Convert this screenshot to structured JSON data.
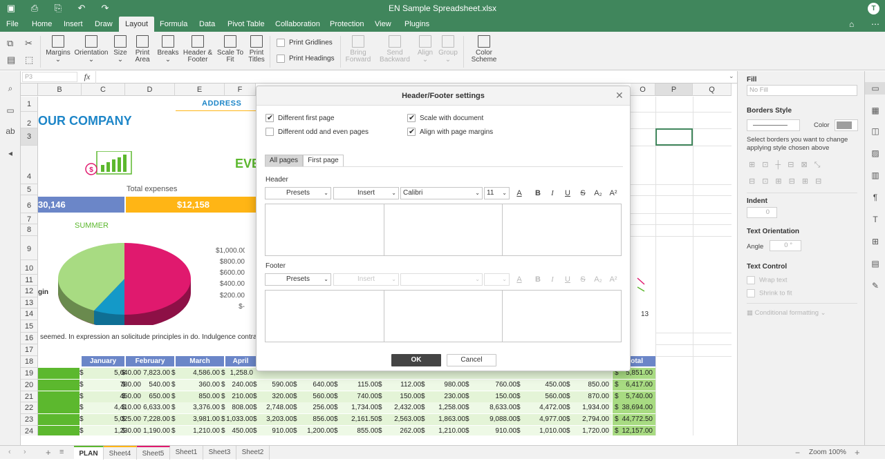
{
  "title_bar": {
    "doc_title": "EN Sample Spreadsheet.xlsx",
    "avatar_letter": "T"
  },
  "menu": {
    "tabs": [
      "File",
      "Home",
      "Insert",
      "Draw",
      "Layout",
      "Formula",
      "Data",
      "Pivot Table",
      "Collaboration",
      "Protection",
      "View",
      "Plugins"
    ]
  },
  "toolbar": {
    "margins": "Margins",
    "orientation": "Orientation",
    "size": "Size",
    "print_area_1": "Print",
    "print_area_2": "Area",
    "breaks": "Breaks",
    "header_footer_1": "Header &",
    "header_footer_2": "Footer",
    "scale_1": "Scale To",
    "scale_2": "Fit",
    "print_titles_1": "Print",
    "print_titles_2": "Titles",
    "print_gridlines": "Print Gridlines",
    "print_headings": "Print Headings",
    "bring_1": "Bring",
    "bring_2": "Forward",
    "send_1": "Send",
    "send_2": "Backward",
    "align": "Align",
    "group": "Group",
    "color_scheme_1": "Color",
    "color_scheme_2": "Scheme"
  },
  "formula_bar": {
    "name_box": "P3",
    "fx": "fx"
  },
  "columns": [
    "B",
    "C",
    "D",
    "E",
    "F",
    "O",
    "P",
    "Q"
  ],
  "rows": [
    "1",
    "2",
    "3",
    "4",
    "5",
    "6",
    "7",
    "8",
    "9",
    "10",
    "11",
    "12",
    "13",
    "14",
    "15",
    "16",
    "17",
    "18",
    "19",
    "20",
    "21",
    "22",
    "23",
    "24"
  ],
  "sheet": {
    "address": "ADDRESS",
    "company": "OUR COMPANY",
    "eve": "EVE",
    "total_expenses": "Total expenses",
    "value_left": "30,146",
    "value_center": "$12,158",
    "summer": "SUMMER",
    "margin": "gin",
    "y_ticks": [
      "$1,000.00",
      "$800.00",
      "$600.00",
      "$400.00",
      "$200.00",
      "$-"
    ],
    "text_row16": "seemed. In expression an solicitude principles in do. Indulgence contrasted suffi",
    "x_label_13": "13",
    "month_headers": [
      "January",
      "February",
      "March",
      "April"
    ],
    "total_header": "otal",
    "data_rows": [
      {
        "b": "5,640.00",
        "c": "7,823.00",
        "d": "4,586.00",
        "e": "1,258.0",
        "total": "5,851.00"
      },
      {
        "b": "780.00",
        "c": "540.00",
        "d": "360.00",
        "e": "240.00",
        "f": "590.00",
        "g": "640.00",
        "h": "115.00",
        "i": "112.00",
        "j": "980.00",
        "k": "760.00",
        "l": "450.00",
        "m": "850.00",
        "total": "6,417.00"
      },
      {
        "b": "450.00",
        "c": "650.00",
        "d": "850.00",
        "e": "210.00",
        "f": "320.00",
        "g": "560.00",
        "h": "740.00",
        "i": "150.00",
        "j": "230.00",
        "k": "150.00",
        "l": "560.00",
        "m": "870.00",
        "total": "5,740.00"
      },
      {
        "b": "4,410.00",
        "c": "6,633.00",
        "d": "3,376.00",
        "e": "808.00",
        "f": "2,748.00",
        "g": "256.00",
        "h": "1,734.00",
        "i": "2,432.00",
        "j": "1,258.00",
        "k": "8,633.00",
        "l": "4,472.00",
        "m": "1,934.00",
        "total": "38,694.00"
      },
      {
        "b": "5,025.00",
        "c": "7,228.00",
        "d": "3,981.00",
        "e": "1,033.00",
        "f": "3,203.00",
        "g": "856.00",
        "h": "2,161.50",
        "i": "2,563.00",
        "j": "1,863.00",
        "k": "9,088.00",
        "l": "4,977.00",
        "m": "2,794.00",
        "total": "44,772.50"
      },
      {
        "b": "1,230.00",
        "c": "1,190.00",
        "d": "1,210.00",
        "e": "450.00",
        "f": "910.00",
        "g": "1,200.00",
        "h": "855.00",
        "i": "262.00",
        "j": "1,210.00",
        "k": "910.00",
        "l": "1,010.00",
        "m": "1,720.00",
        "total": "12,157.00"
      }
    ]
  },
  "right_panel": {
    "fill": "Fill",
    "fill_value": "No Fill",
    "borders_style": "Borders Style",
    "color": "Color",
    "borders_hint": "Select borders you want to change applying style chosen above",
    "indent": "Indent",
    "indent_value": "0",
    "text_orientation": "Text Orientation",
    "angle": "Angle",
    "angle_value": "0 °",
    "text_control": "Text Control",
    "wrap_text": "Wrap text",
    "shrink_to_fit": "Shrink to fit",
    "conditional_formatting": "Conditional formatting"
  },
  "status_bar": {
    "sheets": [
      "PLAN",
      "Sheet4",
      "Sheet5",
      "Sheet1",
      "Sheet3",
      "Sheet2"
    ],
    "zoom": "Zoom 100%"
  },
  "dialog": {
    "title": "Header/Footer settings",
    "different_first_page": "Different first page",
    "different_odd_even": "Different odd and even pages",
    "scale_with_document": "Scale with document",
    "align_with_margins": "Align with page margins",
    "tab_all_pages": "All pages",
    "tab_first_page": "First page",
    "header_label": "Header",
    "footer_label": "Footer",
    "presets": "Presets",
    "insert": "Insert",
    "font": "Calibri",
    "font_size": "11",
    "ok": "OK",
    "cancel": "Cancel"
  },
  "colors": {
    "brand_green": "#40865c",
    "company_blue": "#1e86c8",
    "orange": "#ffb515",
    "pink": "#e0196e",
    "light_green": "#a8db82",
    "teal": "#1499c8",
    "header_blue": "#6b86c8"
  }
}
